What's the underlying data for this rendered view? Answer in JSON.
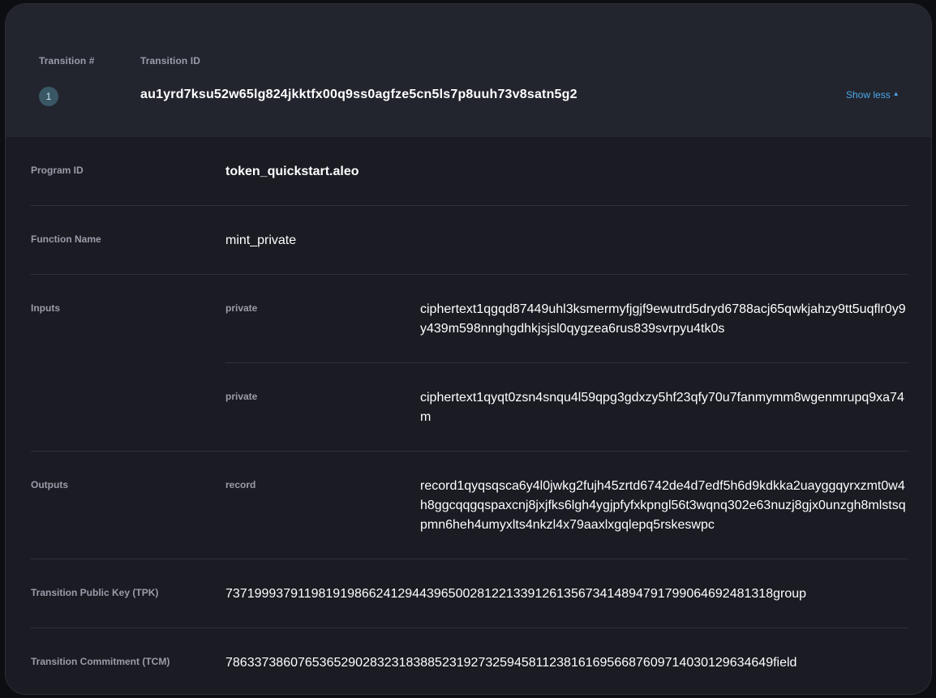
{
  "header": {
    "col_number_label": "Transition #",
    "col_id_label": "Transition ID",
    "number": "1",
    "transition_id": "au1yrd7ksu52w65lg824jkktfx00q9ss0agfze5cn5ls7p8uuh73v8satn5g2",
    "toggle_label": "Show less",
    "toggle_icon": "chevron-up-icon"
  },
  "program": {
    "label": "Program ID",
    "value": "token_quickstart.aleo"
  },
  "function": {
    "label": "Function Name",
    "value": "mint_private"
  },
  "inputs": {
    "label": "Inputs",
    "items": [
      {
        "type": "private",
        "value": "ciphertext1qgqd87449uhl3ksmermyfjgjf9ewutrd5dryd6788acj65qwkjahzy9tt5uqflr0y9y439m598nnghgdhkjsjsl0qygzea6rus839svrpyu4tk0s"
      },
      {
        "type": "private",
        "value": "ciphertext1qyqt0zsn4snqu4l59qpg3gdxzy5hf23qfy70u7fanmymm8wgenmrupq9xa74m"
      }
    ]
  },
  "outputs": {
    "label": "Outputs",
    "items": [
      {
        "type": "record",
        "value": "record1qyqsqsca6y4l0jwkg2fujh45zrtd6742de4d7edf5h6d9kdkka2uayggqyrxzmt0w4h8ggcqqgqspaxcnj8jxjfks6lgh4ygjpfyfxkpngl56t3wqnq302e63nuzj8gjx0unzgh8mlstsqpmn6heh4umyxlts4nkzl4x79aaxlxgqlepq5rskeswpc"
      }
    ]
  },
  "tpk": {
    "label": "Transition Public Key (TPK)",
    "value": "7371999379119819198662412944396500281221339126135673414894791799064692481318group"
  },
  "tcm": {
    "label": "Transition Commitment (TCM)",
    "value": "7863373860765365290283231838852319273259458112381616956687609714030129634649field"
  }
}
